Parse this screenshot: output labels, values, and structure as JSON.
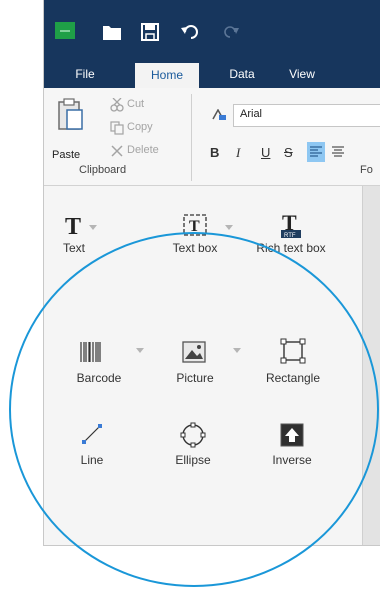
{
  "colors": {
    "titlebar": "#17365d",
    "accent": "#1b5b9c",
    "highlight_circle": "#1a97d8",
    "app_icon": "#1f9f47",
    "align_left_active": "#8ec7f2"
  },
  "quick_access": [
    {
      "name": "app-logo-icon"
    },
    {
      "name": "folder-open-icon"
    },
    {
      "name": "save-icon"
    },
    {
      "name": "undo-icon"
    },
    {
      "name": "redo-icon"
    }
  ],
  "tabs": [
    {
      "label": "File",
      "active": false
    },
    {
      "label": "Home",
      "active": true
    },
    {
      "label": "Data",
      "active": false
    },
    {
      "label": "View",
      "active": false
    }
  ],
  "clipboard": {
    "paste_label": "Paste",
    "cut_label": "Cut",
    "copy_label": "Copy",
    "delete_label": "Delete",
    "group_label": "Clipboard"
  },
  "font": {
    "family_value": "Arial",
    "group_label_partial": "Fo",
    "bold": "B",
    "italic": "I",
    "underline": "U",
    "strikethrough": "S"
  },
  "tools": [
    {
      "label": "Text",
      "icon": "text-icon"
    },
    {
      "label": "Text box",
      "icon": "text-box-icon"
    },
    {
      "label": "Rich text box",
      "icon": "rich-text-box-icon"
    },
    {
      "label": "Barcode",
      "icon": "barcode-icon"
    },
    {
      "label": "Picture",
      "icon": "picture-icon"
    },
    {
      "label": "Rectangle",
      "icon": "rectangle-icon"
    },
    {
      "label": "Line",
      "icon": "line-icon"
    },
    {
      "label": "Ellipse",
      "icon": "ellipse-icon"
    },
    {
      "label": "Inverse",
      "icon": "inverse-icon"
    }
  ]
}
